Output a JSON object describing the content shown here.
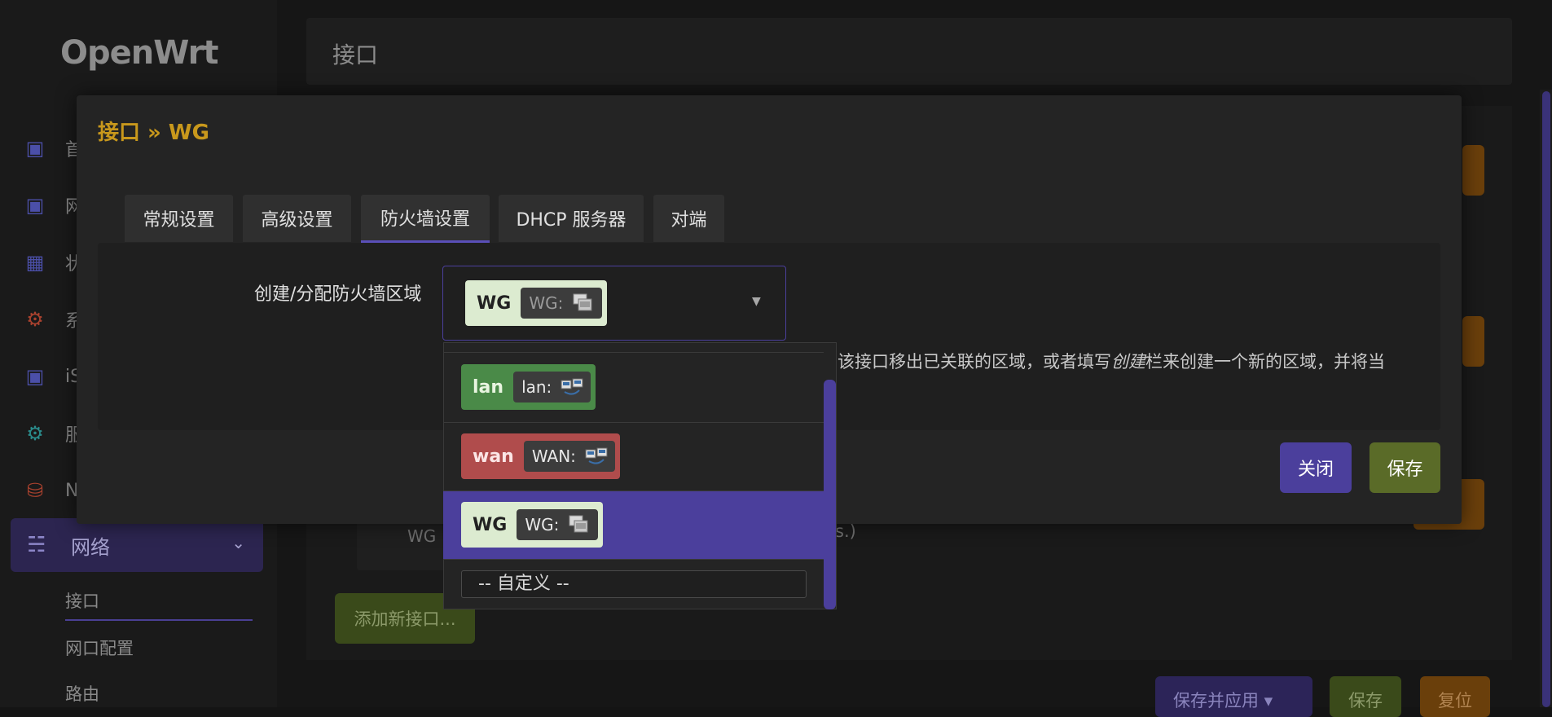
{
  "app": {
    "logo": "OpenWrt"
  },
  "sidebar": {
    "items": [
      {
        "label": "首",
        "icon": "cube-icon"
      },
      {
        "label": "网",
        "icon": "cube-icon"
      },
      {
        "label": "状",
        "icon": "dashboard-icon"
      },
      {
        "label": "系",
        "icon": "gear-icon"
      },
      {
        "label": "iS",
        "icon": "cube-icon"
      },
      {
        "label": "服",
        "icon": "gears-icon"
      },
      {
        "label": "N",
        "icon": "database-icon"
      }
    ],
    "active": {
      "label": "网络",
      "icon": "sitemap-icon"
    },
    "sub": [
      "接口",
      "网口配置",
      "路由"
    ]
  },
  "page": {
    "title": "接口",
    "bg_wg": "WG",
    "bg_suffix": "s.)",
    "add_button": "添加新接口...",
    "save_apply": "保存并应用 ▾",
    "save": "保存",
    "reset": "复位"
  },
  "modal": {
    "title": "接口 » WG",
    "tabs": [
      "常规设置",
      "高级设置",
      "防火墙设置",
      "DHCP 服务器",
      "对端"
    ],
    "active_tab": "防火墙设置",
    "field_label": "创建/分配防火墙区域",
    "selected": {
      "name": "WG",
      "detail": "WG:"
    },
    "help_before": "该接口移出已关联的区域，或者填写",
    "help_italic": "创建",
    "help_after": "栏来创建一个新的区域，并将当",
    "close": "关闭",
    "save": "保存"
  },
  "dropdown": {
    "options": [
      {
        "name": "lan",
        "detail": "lan:"
      },
      {
        "name": "wan",
        "detail": "WAN:"
      },
      {
        "name": "WG",
        "detail": "WG:"
      }
    ],
    "custom_placeholder": "-- 自定义 --"
  },
  "colors": {
    "accent": "#4b3f9c",
    "title": "#c8981c",
    "lan_zone": "#4a8a48",
    "wan_zone": "#b04c4c",
    "wg_zone": "#dcebd0"
  }
}
